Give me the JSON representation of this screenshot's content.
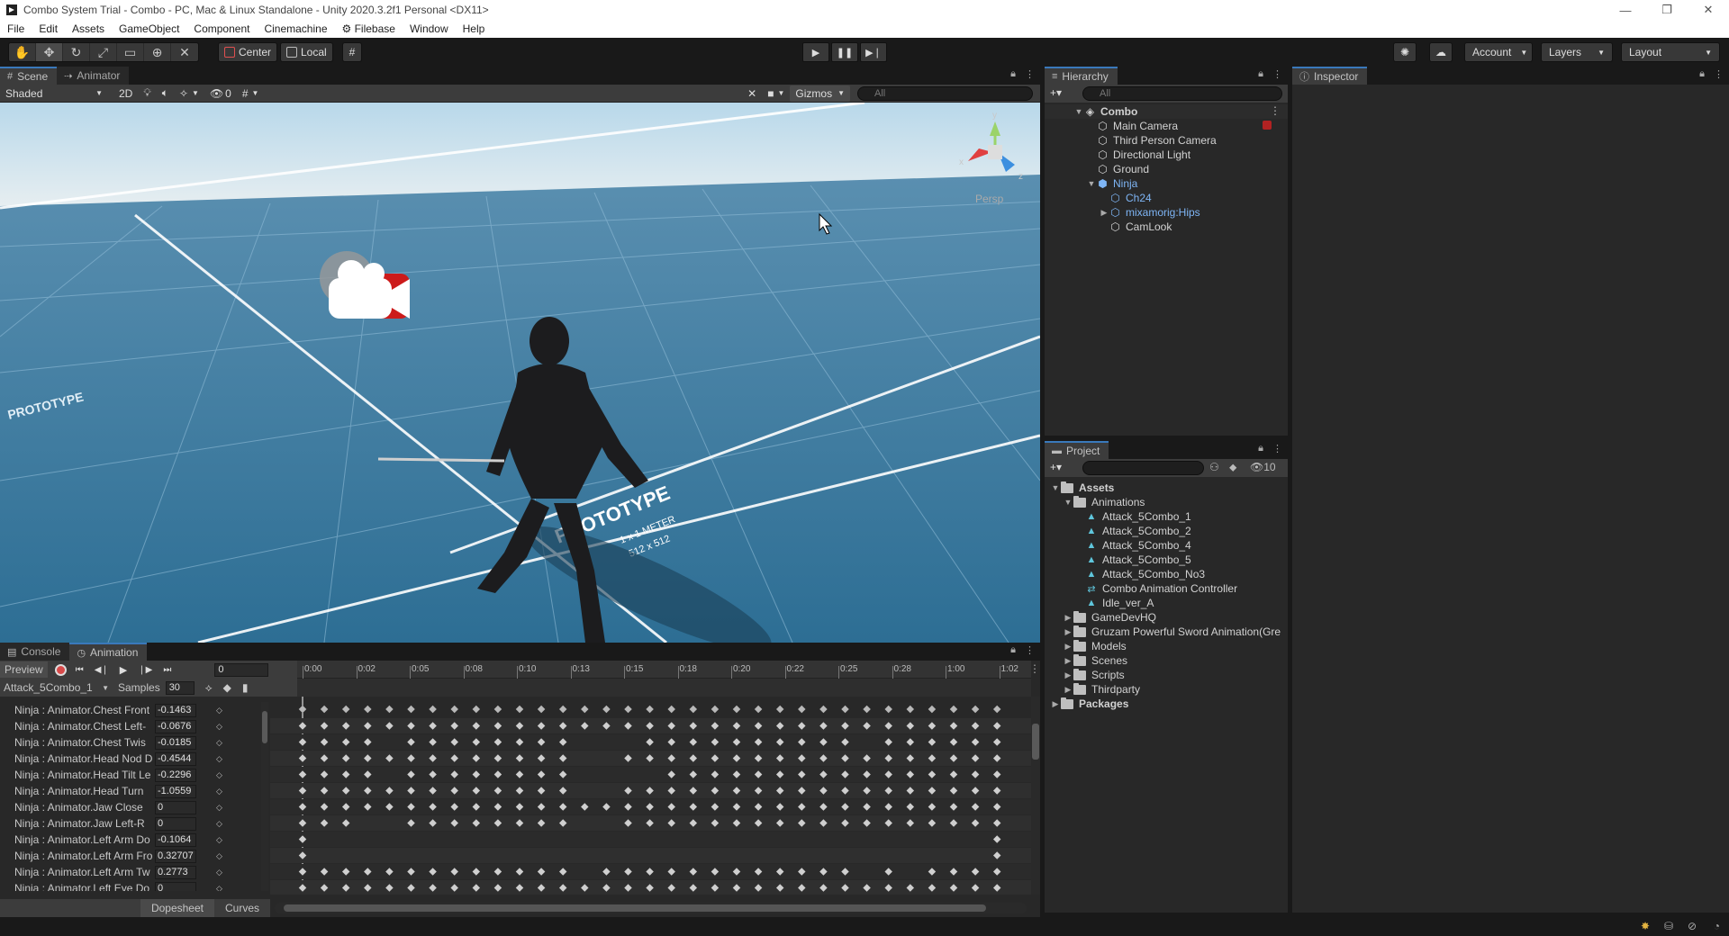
{
  "window": {
    "title": "Combo System Trial - Combo - PC, Mac & Linux Standalone - Unity 2020.3.2f1 Personal <DX11>",
    "controls": [
      "—",
      "❐",
      "✕"
    ]
  },
  "menu": [
    "File",
    "Edit",
    "Assets",
    "GameObject",
    "Component",
    "Cinemachine",
    "Filebase",
    "Window",
    "Help"
  ],
  "toolbar": {
    "pivot_center": "Center",
    "pivot_local": "Local",
    "account": "Account",
    "layers": "Layers",
    "layout": "Layout"
  },
  "scene": {
    "tabs": [
      "Scene",
      "Animator"
    ],
    "shading": "Shaded",
    "mode_2d": "2D",
    "hidden_count": "0",
    "gizmos": "Gizmos",
    "search_placeholder": "All",
    "persp_label": "Persp",
    "axis_x": "x",
    "axis_y": "y",
    "axis_z": "z",
    "ground_label_1": "PROTOTYPE",
    "ground_label_2": "1 x 1 METER",
    "ground_label_3": "512 x 512"
  },
  "hierarchy": {
    "tab": "Hierarchy",
    "search_placeholder": "All",
    "scene_name": "Combo",
    "items": [
      {
        "label": "Main Camera",
        "depth": 1
      },
      {
        "label": "Third Person Camera",
        "depth": 1
      },
      {
        "label": "Directional Light",
        "depth": 1
      },
      {
        "label": "Ground",
        "depth": 1
      },
      {
        "label": "Ninja",
        "depth": 1
      },
      {
        "label": "Ch24",
        "depth": 2
      },
      {
        "label": "mixamorig:Hips",
        "depth": 2
      },
      {
        "label": "CamLook",
        "depth": 2
      }
    ]
  },
  "inspector": {
    "tab": "Inspector"
  },
  "project": {
    "tab": "Project",
    "hidden_count": "10",
    "tree": [
      {
        "label": "Assets",
        "depth": 0,
        "type": "folder",
        "bold": true
      },
      {
        "label": "Animations",
        "depth": 1,
        "type": "folder"
      },
      {
        "label": "Attack_5Combo_1",
        "depth": 2,
        "type": "anim"
      },
      {
        "label": "Attack_5Combo_2",
        "depth": 2,
        "type": "anim"
      },
      {
        "label": "Attack_5Combo_4",
        "depth": 2,
        "type": "anim"
      },
      {
        "label": "Attack_5Combo_5",
        "depth": 2,
        "type": "anim"
      },
      {
        "label": "Attack_5Combo_No3",
        "depth": 2,
        "type": "anim"
      },
      {
        "label": "Combo Animation Controller",
        "depth": 2,
        "type": "controller"
      },
      {
        "label": "Idle_ver_A",
        "depth": 2,
        "type": "anim"
      },
      {
        "label": "GameDevHQ",
        "depth": 1,
        "type": "folder"
      },
      {
        "label": "Gruzam Powerful Sword Animation(Gre",
        "depth": 1,
        "type": "folder"
      },
      {
        "label": "Models",
        "depth": 1,
        "type": "folder"
      },
      {
        "label": "Scenes",
        "depth": 1,
        "type": "folder"
      },
      {
        "label": "Scripts",
        "depth": 1,
        "type": "folder"
      },
      {
        "label": "Thirdparty",
        "depth": 1,
        "type": "folder"
      },
      {
        "label": "Packages",
        "depth": 0,
        "type": "folder",
        "bold": true
      }
    ]
  },
  "animation": {
    "tabs": [
      "Console",
      "Animation"
    ],
    "preview": "Preview",
    "frame": "0",
    "clip": "Attack_5Combo_1",
    "samples_label": "Samples",
    "samples": "30",
    "time_labels": [
      "0:00",
      "0:02",
      "0:05",
      "0:08",
      "0:10",
      "0:13",
      "0:15",
      "0:18",
      "0:20",
      "0:22",
      "0:25",
      "0:28",
      "1:00",
      "1:02"
    ],
    "bottom_tabs": [
      "Dopesheet",
      "Curves"
    ],
    "curves": [
      {
        "name": "Ninja : Animator.Chest Front",
        "value": "-0.1463"
      },
      {
        "name": "Ninja : Animator.Chest Left-",
        "value": "-0.0676"
      },
      {
        "name": "Ninja : Animator.Chest Twis",
        "value": "-0.0185"
      },
      {
        "name": "Ninja : Animator.Head Nod D",
        "value": "-0.4544"
      },
      {
        "name": "Ninja : Animator.Head Tilt Le",
        "value": "-0.2296"
      },
      {
        "name": "Ninja : Animator.Head Turn",
        "value": "-1.0559"
      },
      {
        "name": "Ninja : Animator.Jaw Close",
        "value": "0"
      },
      {
        "name": "Ninja : Animator.Jaw Left-R",
        "value": "0"
      },
      {
        "name": "Ninja : Animator.Left Arm Do",
        "value": "-0.1064"
      },
      {
        "name": "Ninja : Animator.Left Arm Fro",
        "value": "0.32707"
      },
      {
        "name": "Ninja : Animator.Left Arm Tw",
        "value": "0.2773"
      },
      {
        "name": "Ninja : Animator.Left Eye Do",
        "value": "0"
      }
    ],
    "key_rows": [
      [
        0,
        2,
        4,
        6,
        8,
        10,
        12,
        14,
        16,
        18,
        20,
        22,
        24,
        26,
        28,
        30,
        32,
        34,
        36,
        38,
        40,
        42,
        44,
        46,
        48,
        50,
        52,
        54,
        56,
        58,
        60,
        62,
        64
      ],
      [
        0,
        2,
        4,
        6,
        10,
        12,
        14,
        16,
        18,
        20,
        22,
        24,
        32,
        34,
        36,
        38,
        40,
        42,
        44,
        46,
        48,
        50,
        54,
        56,
        58,
        60,
        62,
        64
      ],
      [
        0,
        2,
        4,
        6,
        8,
        10,
        12,
        14,
        16,
        18,
        20,
        22,
        24,
        30,
        32,
        34,
        36,
        38,
        40,
        42,
        44,
        46,
        48,
        50,
        52,
        54,
        56,
        58,
        60,
        62,
        64
      ],
      [
        0,
        2,
        4,
        6,
        10,
        12,
        14,
        16,
        18,
        20,
        22,
        24,
        34,
        36,
        38,
        40,
        42,
        44,
        46,
        48,
        50,
        52,
        54,
        56,
        58,
        60,
        62,
        64
      ],
      [
        0,
        2,
        4,
        6,
        8,
        10,
        12,
        14,
        16,
        18,
        20,
        22,
        24,
        30,
        32,
        34,
        36,
        38,
        40,
        42,
        44,
        46,
        48,
        50,
        52,
        54,
        56,
        58,
        60,
        62,
        64
      ],
      [
        0,
        2,
        4,
        6,
        8,
        10,
        12,
        14,
        16,
        18,
        20,
        22,
        24,
        26,
        28,
        30,
        32,
        34,
        36,
        38,
        40,
        42,
        44,
        46,
        48,
        50,
        52,
        54,
        56,
        58,
        60,
        62,
        64
      ],
      [
        0,
        2,
        4,
        10,
        12,
        14,
        16,
        18,
        20,
        22,
        24,
        30,
        32,
        34,
        36,
        38,
        40,
        42,
        44,
        46,
        48,
        50,
        52,
        54,
        56,
        58,
        60,
        62,
        64
      ],
      [
        0,
        64
      ],
      [
        0,
        64
      ],
      [
        0,
        2,
        4,
        6,
        8,
        10,
        12,
        14,
        16,
        18,
        20,
        22,
        24,
        28,
        30,
        32,
        34,
        36,
        38,
        40,
        42,
        44,
        46,
        48,
        50,
        54,
        58,
        60,
        62,
        64
      ],
      [
        0,
        2,
        4,
        6,
        8,
        10,
        12,
        14,
        16,
        18,
        20,
        22,
        24,
        26,
        28,
        30,
        32,
        34,
        36,
        38,
        40,
        42,
        44,
        46,
        48,
        50,
        52,
        54,
        56,
        58,
        60,
        62,
        64
      ],
      [
        0,
        2,
        4,
        6,
        8,
        10,
        12,
        14,
        16,
        18,
        20,
        22,
        24,
        28,
        34,
        36,
        40,
        42,
        44,
        46,
        48,
        50,
        54,
        56,
        58,
        60,
        62,
        64
      ]
    ]
  },
  "colors": {
    "accent_blue": "#3a79bb",
    "record_red": "#d84a4a",
    "hierarchy_prefab_blue": "#7eb5f5"
  }
}
